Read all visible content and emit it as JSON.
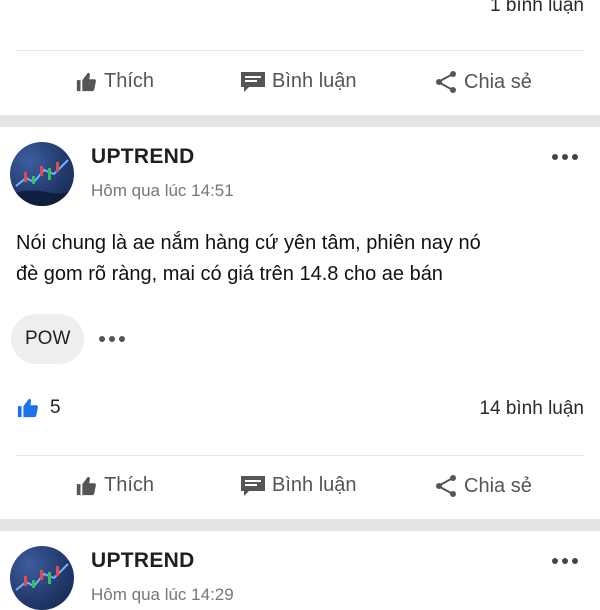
{
  "post_prev": {
    "comments_text": "1 bình luận"
  },
  "actions": {
    "like_label": "Thích",
    "comment_label": "Bình luận",
    "share_label": "Chia sẻ"
  },
  "post1": {
    "author": "UPTREND",
    "timestamp": "Hôm qua lúc 14:51",
    "content_line1": "Nói chung là ae nắm hàng cứ yên tâm, phiên nay nó",
    "content_line2": "đè gom rõ ràng, mai có giá trên 14.8 cho ae bán",
    "tag": "POW",
    "likes": "5",
    "comments_text": "14 bình luận"
  },
  "post2": {
    "author": "UPTREND",
    "timestamp": "Hôm qua lúc 14:29"
  },
  "colors": {
    "like_blue": "#1a73e8",
    "icon_gray": "#555555",
    "separator": "#e4e4e4"
  },
  "icons": [
    "thumbs-up-icon",
    "comment-icon",
    "share-icon",
    "more-icon",
    "avatar-chart-image"
  ]
}
